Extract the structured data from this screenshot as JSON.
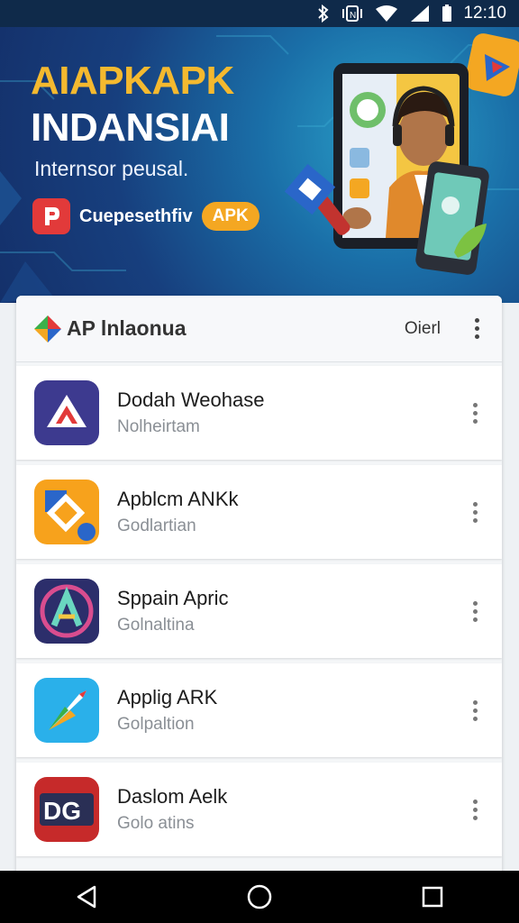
{
  "status_bar": {
    "time": "12:10",
    "icons": [
      "bluetooth-icon",
      "vibrate-icon",
      "wifi-icon",
      "signal-icon",
      "battery-icon"
    ]
  },
  "hero": {
    "title_line1": "AIAPKAPK",
    "title_line2": "INDANSIAI",
    "subtitle": "Internsor peusal.",
    "badge_text": "Cuepesethfiv",
    "apk_pill": "APK",
    "colors": {
      "accent": "#f4b92f",
      "background": "#173f7e"
    }
  },
  "panel": {
    "title": "AP lnlaonua",
    "action": "Oierl"
  },
  "apps": [
    {
      "name": "Dodah Weohase",
      "subtitle": "Nolheirtam",
      "icon": "triangle-logo-icon"
    },
    {
      "name": "Apblcm ANKk",
      "subtitle": "Godlartian",
      "icon": "orange-puzzle-icon"
    },
    {
      "name": "Sppain Apric",
      "subtitle": "Golnaltina",
      "icon": "letter-a-icon"
    },
    {
      "name": "Applig ARK",
      "subtitle": "Golpaltion",
      "icon": "rocket-icon"
    },
    {
      "name": "Daslom Aelk",
      "subtitle": "Golo atins",
      "icon": "dg-logo-icon"
    }
  ],
  "nav": {
    "buttons": [
      "back-icon",
      "home-icon",
      "recents-icon"
    ]
  }
}
